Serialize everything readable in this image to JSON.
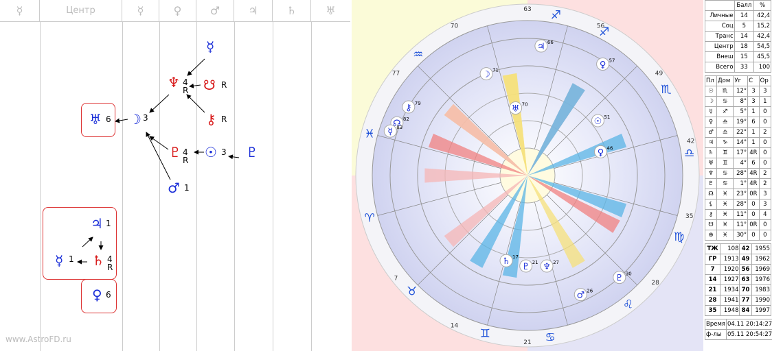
{
  "header": {
    "col0": "☿",
    "col1": "Центр",
    "col2": "☿",
    "col3": "♀",
    "col4": "♂",
    "col5": "♃",
    "col6": "♄",
    "col7": "♅"
  },
  "diagram": {
    "moon": {
      "glyph": "☽",
      "n": "3"
    },
    "uranus_top": {
      "glyph": "♅",
      "n": "6"
    },
    "neptune": {
      "glyph": "♆",
      "n": "4",
      "r": "R"
    },
    "node": {
      "glyph": "☋",
      "r": "R"
    },
    "chiron": {
      "glyph": "⚷",
      "r": "R"
    },
    "mercury_top": {
      "glyph": "☿"
    },
    "pluto": {
      "glyph": "♇",
      "n": "4",
      "r": "R"
    },
    "sun": {
      "glyph": "☉",
      "n": "3"
    },
    "pluto_alt": {
      "glyph": "♇"
    },
    "mars": {
      "glyph": "♂",
      "n": "1"
    },
    "jupiter": {
      "glyph": "♃",
      "n": "1"
    },
    "mercury": {
      "glyph": "☿",
      "n": "1"
    },
    "saturn": {
      "glyph": "♄",
      "n": "4",
      "r": "R"
    },
    "venus": {
      "glyph": "♀",
      "n": "6"
    }
  },
  "watermark": "www.AstroFD.ru",
  "wheel": {
    "degree_labels": [
      "63",
      "56",
      "49",
      "42",
      "35",
      "28",
      "21",
      "14",
      "7",
      "77",
      "70"
    ],
    "planets": [
      {
        "glyph": "♃",
        "deg": "66"
      },
      {
        "glyph": "♀",
        "deg": "57"
      },
      {
        "glyph": "☽",
        "deg": "71"
      },
      {
        "glyph": "☉",
        "deg": "51"
      },
      {
        "glyph": "♅",
        "deg": "70"
      },
      {
        "glyph": "⚷",
        "deg": "79"
      },
      {
        "glyph": "☊",
        "deg": "82"
      },
      {
        "glyph": "☿",
        "deg": "83"
      },
      {
        "glyph": "♀",
        "deg": "46"
      },
      {
        "glyph": "♄",
        "deg": "17"
      },
      {
        "glyph": "♇",
        "deg": "21"
      },
      {
        "glyph": "♆",
        "deg": "27"
      },
      {
        "glyph": "♇",
        "deg": "30"
      },
      {
        "glyph": "♂",
        "deg": "26"
      }
    ],
    "signs": [
      "♐",
      "♐",
      "♏",
      "♎",
      "♍",
      "♌",
      "♋",
      "♊",
      "♉",
      "♈",
      "♓",
      "♒"
    ],
    "house_numbers": [
      "1",
      "2",
      "3",
      "4",
      "5",
      "6",
      "5",
      "6",
      "2",
      "5",
      "6",
      "2",
      "5",
      "6"
    ]
  },
  "score_table": {
    "headers": [
      "",
      "Балл",
      "%"
    ],
    "rows": [
      [
        "Личные",
        "14",
        "42,4"
      ],
      [
        "Соц",
        "5",
        "15,2"
      ],
      [
        "Транс",
        "14",
        "42,4"
      ],
      [
        "Центр",
        "18",
        "54,5"
      ],
      [
        "Внеш",
        "15",
        "45,5"
      ],
      [
        "Всего",
        "33",
        "100"
      ]
    ]
  },
  "planet_table": {
    "headers": [
      "Пл",
      "Дом",
      "Уг",
      "С",
      "Ор"
    ],
    "rows": [
      [
        "☉",
        "♏",
        "12°",
        "3",
        "3"
      ],
      [
        "☽",
        "♋",
        "8°",
        "3",
        "1"
      ],
      [
        "☿",
        "♐",
        "5°",
        "1",
        "0"
      ],
      [
        "♀",
        "♎",
        "19°",
        "6",
        "0"
      ],
      [
        "♂",
        "♎",
        "22°",
        "1",
        "2"
      ],
      [
        "♃",
        "♑",
        "14°",
        "1",
        "0"
      ],
      [
        "♄",
        "♊",
        "17°",
        "4R",
        "0"
      ],
      [
        "♅",
        "♊",
        "4°",
        "6",
        "0"
      ],
      [
        "♆",
        "♋",
        "28°",
        "4R",
        "2"
      ],
      [
        "♇",
        "♋",
        "1°",
        "4R",
        "2"
      ],
      [
        "☊",
        "♓",
        "23°",
        "0R",
        "3"
      ],
      [
        "⚸",
        "♓",
        "28°",
        "0",
        "3"
      ],
      [
        "⚷",
        "♓",
        "11°",
        "0",
        "4"
      ],
      [
        "☋",
        "♓",
        "11°",
        "0R",
        "0"
      ],
      [
        "⊕",
        "♓",
        "30°",
        "0",
        "0"
      ]
    ]
  },
  "years_table": {
    "rows": [
      [
        "ТЖ",
        "108",
        "42",
        "1955"
      ],
      [
        "ГР",
        "1913",
        "49",
        "1962"
      ],
      [
        "7",
        "1920",
        "56",
        "1969"
      ],
      [
        "14",
        "1927",
        "63",
        "1976"
      ],
      [
        "21",
        "1934",
        "70",
        "1983"
      ],
      [
        "28",
        "1941",
        "77",
        "1990"
      ],
      [
        "35",
        "1948",
        "84",
        "1997"
      ]
    ]
  },
  "footer_table": {
    "rows": [
      [
        "Время",
        "04.11 20:14:27"
      ],
      [
        "ф-лы",
        "05.11 20:54:27"
      ]
    ]
  }
}
